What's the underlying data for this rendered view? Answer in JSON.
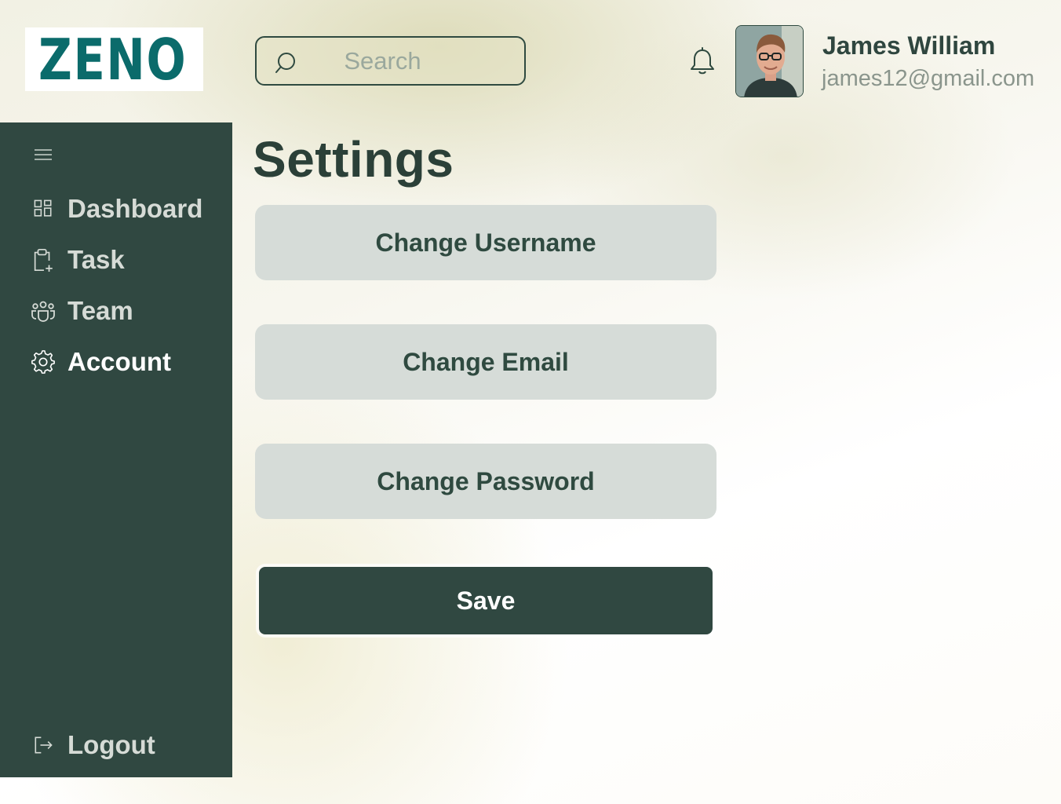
{
  "brand": {
    "name": "ZENO",
    "color": "#0b6b6b"
  },
  "search": {
    "placeholder": "Search",
    "value": ""
  },
  "user": {
    "name": "James William",
    "email": "james12@gmail.com"
  },
  "sidebar": {
    "items": [
      {
        "label": "Dashboard",
        "icon": "grid-icon"
      },
      {
        "label": "Task",
        "icon": "clipboard-plus-icon"
      },
      {
        "label": "Team",
        "icon": "team-icon"
      },
      {
        "label": "Account",
        "icon": "gear-icon",
        "active": true
      }
    ],
    "logout": {
      "label": "Logout",
      "icon": "logout-icon"
    }
  },
  "main": {
    "title": "Settings",
    "options": [
      "Change Username",
      "Change Email",
      "Change Password"
    ],
    "save_label": "Save"
  },
  "colors": {
    "sidebar": "#304841",
    "primary_text": "#2b4038",
    "option_bg": "#d6dcd8",
    "accent": "#0b6b6b"
  }
}
